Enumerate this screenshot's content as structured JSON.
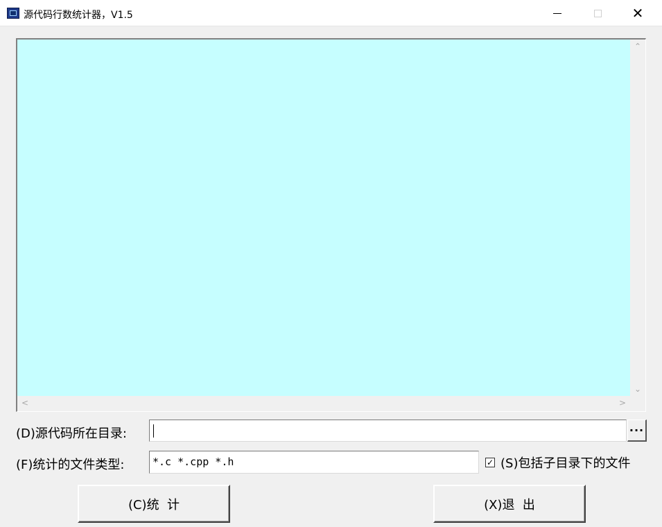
{
  "window": {
    "title": "源代码行数统计器，V1.5",
    "controls": {
      "minimize": "–",
      "maximize": "□",
      "close": "✕"
    }
  },
  "output": {
    "background": "#c6feff",
    "scroll_up": "⌃",
    "scroll_down": "⌄",
    "scroll_left": "<",
    "scroll_right": ">"
  },
  "form": {
    "dir_label": "(D)源代码所在目录:",
    "dir_value": "",
    "browse_label": "···",
    "type_label": "(F)统计的文件类型:",
    "type_value": "*.c *.cpp *.h",
    "subdir_checked": true,
    "subdir_check_mark": "✓",
    "subdir_label": "(S)包括子目录下的文件"
  },
  "buttons": {
    "count_label": "(C)统  计",
    "exit_label": "(X)退  出"
  }
}
